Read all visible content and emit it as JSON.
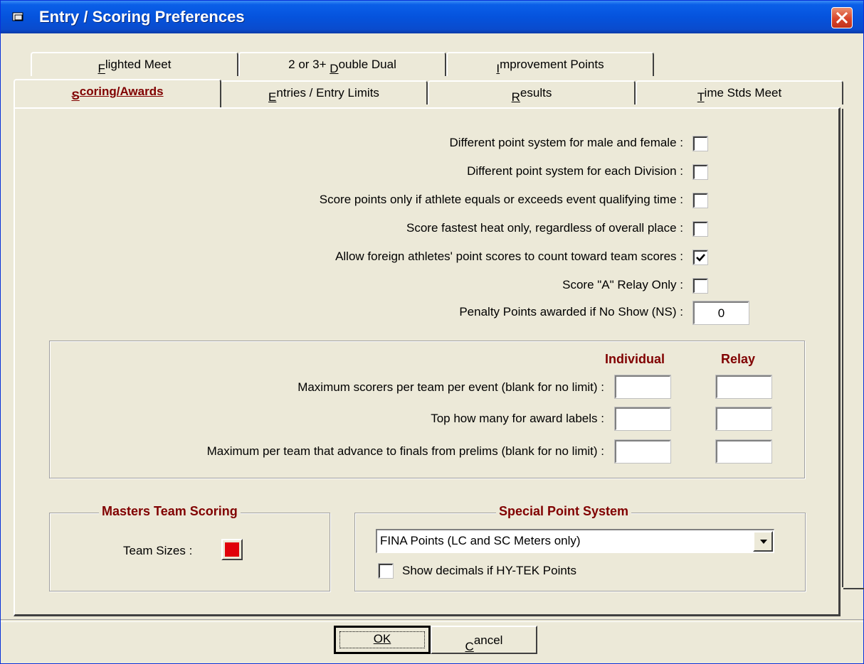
{
  "window": {
    "title": "Entry / Scoring Preferences",
    "title_bar_color": "#0553dd",
    "close_button_color": "#d8442a"
  },
  "tabs": {
    "row_back": [
      {
        "label": "Flighted Meet",
        "mnemonic": "F"
      },
      {
        "label": "2 or 3+ Double Dual",
        "mnemonic": "D"
      },
      {
        "label": "Improvement Points",
        "mnemonic": "I"
      }
    ],
    "row_front": [
      {
        "label": "Scoring/Awards",
        "mnemonic": "S",
        "active": true
      },
      {
        "label": "Entries / Entry Limits",
        "mnemonic": "E"
      },
      {
        "label": "Results",
        "mnemonic": "R"
      },
      {
        "label": "Time Stds Meet",
        "mnemonic": "T"
      }
    ]
  },
  "options": [
    {
      "label": "Different point system for male and female :",
      "checked": false
    },
    {
      "label": "Different point system for each Division :",
      "checked": false
    },
    {
      "label": "Score points only if athlete equals or exceeds event qualifying time :",
      "checked": false
    },
    {
      "label": "Score fastest heat only, regardless of overall place :",
      "checked": false
    },
    {
      "label": "Allow foreign athletes' point scores to count toward team scores :",
      "checked": true
    },
    {
      "label": "Score \"A\" Relay Only :",
      "checked": false
    }
  ],
  "penalty": {
    "label": "Penalty Points awarded if No Show (NS) :",
    "value": "0"
  },
  "limits": {
    "col_individual": "Individual",
    "col_relay": "Relay",
    "rows": [
      {
        "label": "Maximum scorers per team per event (blank for no limit) :",
        "individual": "",
        "relay": ""
      },
      {
        "label": "Top how many for award labels :",
        "individual": "",
        "relay": ""
      },
      {
        "label": "Maximum per team that advance to finals from prelims (blank for no limit) :",
        "individual": "",
        "relay": ""
      }
    ]
  },
  "masters": {
    "title": "Masters Team Scoring",
    "team_sizes_label": "Team Sizes :",
    "color": "#e0000a"
  },
  "special": {
    "title": "Special Point System",
    "selected": "FINA Points (LC and SC Meters only)",
    "decimals_label": "Show decimals if HY-TEK Points",
    "decimals_checked": false
  },
  "buttons": {
    "ok": "OK",
    "cancel": "Cancel"
  },
  "accent_text_color": "#800000"
}
